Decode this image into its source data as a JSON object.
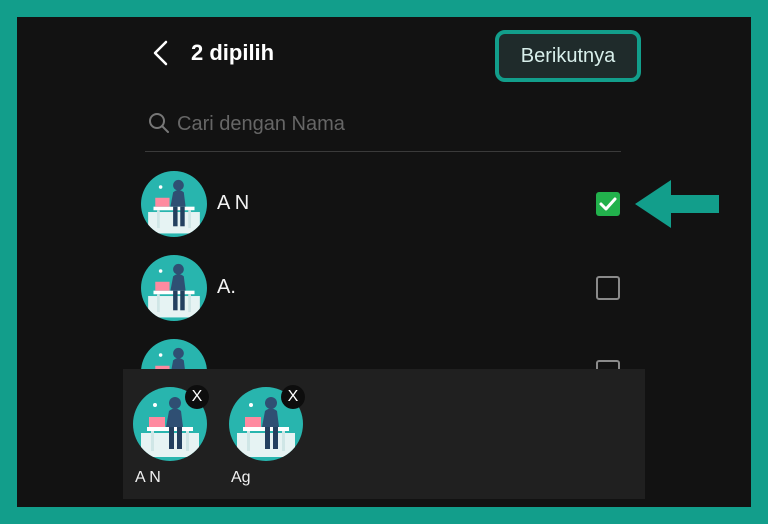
{
  "header": {
    "title": "2 dipilih",
    "next_label": "Berikutnya"
  },
  "search": {
    "placeholder": "Cari dengan Nama"
  },
  "contacts": [
    {
      "name": "A N",
      "checked": true
    },
    {
      "name": "A.",
      "checked": false
    },
    {
      "name": "",
      "checked": false
    }
  ],
  "selected": [
    {
      "name": "A N",
      "remove_label": "X"
    },
    {
      "name": "Ag",
      "remove_label": "X"
    }
  ],
  "colors": {
    "accent": "#129e8b",
    "check": "#22b14c",
    "avatar_bg": "#28b5ae",
    "background": "#121212"
  }
}
